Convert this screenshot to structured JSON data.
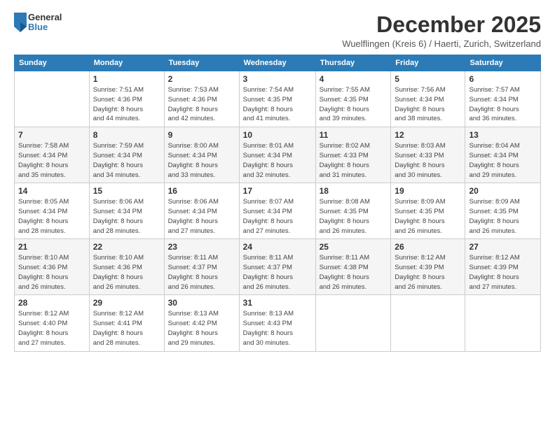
{
  "logo": {
    "general": "General",
    "blue": "Blue"
  },
  "header": {
    "month": "December 2025",
    "location": "Wuelflingen (Kreis 6) / Haerti, Zurich, Switzerland"
  },
  "days_of_week": [
    "Sunday",
    "Monday",
    "Tuesday",
    "Wednesday",
    "Thursday",
    "Friday",
    "Saturday"
  ],
  "weeks": [
    [
      {
        "day": "",
        "info": ""
      },
      {
        "day": "1",
        "info": "Sunrise: 7:51 AM\nSunset: 4:36 PM\nDaylight: 8 hours\nand 44 minutes."
      },
      {
        "day": "2",
        "info": "Sunrise: 7:53 AM\nSunset: 4:36 PM\nDaylight: 8 hours\nand 42 minutes."
      },
      {
        "day": "3",
        "info": "Sunrise: 7:54 AM\nSunset: 4:35 PM\nDaylight: 8 hours\nand 41 minutes."
      },
      {
        "day": "4",
        "info": "Sunrise: 7:55 AM\nSunset: 4:35 PM\nDaylight: 8 hours\nand 39 minutes."
      },
      {
        "day": "5",
        "info": "Sunrise: 7:56 AM\nSunset: 4:34 PM\nDaylight: 8 hours\nand 38 minutes."
      },
      {
        "day": "6",
        "info": "Sunrise: 7:57 AM\nSunset: 4:34 PM\nDaylight: 8 hours\nand 36 minutes."
      }
    ],
    [
      {
        "day": "7",
        "info": "Sunrise: 7:58 AM\nSunset: 4:34 PM\nDaylight: 8 hours\nand 35 minutes."
      },
      {
        "day": "8",
        "info": "Sunrise: 7:59 AM\nSunset: 4:34 PM\nDaylight: 8 hours\nand 34 minutes."
      },
      {
        "day": "9",
        "info": "Sunrise: 8:00 AM\nSunset: 4:34 PM\nDaylight: 8 hours\nand 33 minutes."
      },
      {
        "day": "10",
        "info": "Sunrise: 8:01 AM\nSunset: 4:34 PM\nDaylight: 8 hours\nand 32 minutes."
      },
      {
        "day": "11",
        "info": "Sunrise: 8:02 AM\nSunset: 4:33 PM\nDaylight: 8 hours\nand 31 minutes."
      },
      {
        "day": "12",
        "info": "Sunrise: 8:03 AM\nSunset: 4:33 PM\nDaylight: 8 hours\nand 30 minutes."
      },
      {
        "day": "13",
        "info": "Sunrise: 8:04 AM\nSunset: 4:34 PM\nDaylight: 8 hours\nand 29 minutes."
      }
    ],
    [
      {
        "day": "14",
        "info": "Sunrise: 8:05 AM\nSunset: 4:34 PM\nDaylight: 8 hours\nand 28 minutes."
      },
      {
        "day": "15",
        "info": "Sunrise: 8:06 AM\nSunset: 4:34 PM\nDaylight: 8 hours\nand 28 minutes."
      },
      {
        "day": "16",
        "info": "Sunrise: 8:06 AM\nSunset: 4:34 PM\nDaylight: 8 hours\nand 27 minutes."
      },
      {
        "day": "17",
        "info": "Sunrise: 8:07 AM\nSunset: 4:34 PM\nDaylight: 8 hours\nand 27 minutes."
      },
      {
        "day": "18",
        "info": "Sunrise: 8:08 AM\nSunset: 4:35 PM\nDaylight: 8 hours\nand 26 minutes."
      },
      {
        "day": "19",
        "info": "Sunrise: 8:09 AM\nSunset: 4:35 PM\nDaylight: 8 hours\nand 26 minutes."
      },
      {
        "day": "20",
        "info": "Sunrise: 8:09 AM\nSunset: 4:35 PM\nDaylight: 8 hours\nand 26 minutes."
      }
    ],
    [
      {
        "day": "21",
        "info": "Sunrise: 8:10 AM\nSunset: 4:36 PM\nDaylight: 8 hours\nand 26 minutes."
      },
      {
        "day": "22",
        "info": "Sunrise: 8:10 AM\nSunset: 4:36 PM\nDaylight: 8 hours\nand 26 minutes."
      },
      {
        "day": "23",
        "info": "Sunrise: 8:11 AM\nSunset: 4:37 PM\nDaylight: 8 hours\nand 26 minutes."
      },
      {
        "day": "24",
        "info": "Sunrise: 8:11 AM\nSunset: 4:37 PM\nDaylight: 8 hours\nand 26 minutes."
      },
      {
        "day": "25",
        "info": "Sunrise: 8:11 AM\nSunset: 4:38 PM\nDaylight: 8 hours\nand 26 minutes."
      },
      {
        "day": "26",
        "info": "Sunrise: 8:12 AM\nSunset: 4:39 PM\nDaylight: 8 hours\nand 26 minutes."
      },
      {
        "day": "27",
        "info": "Sunrise: 8:12 AM\nSunset: 4:39 PM\nDaylight: 8 hours\nand 27 minutes."
      }
    ],
    [
      {
        "day": "28",
        "info": "Sunrise: 8:12 AM\nSunset: 4:40 PM\nDaylight: 8 hours\nand 27 minutes."
      },
      {
        "day": "29",
        "info": "Sunrise: 8:12 AM\nSunset: 4:41 PM\nDaylight: 8 hours\nand 28 minutes."
      },
      {
        "day": "30",
        "info": "Sunrise: 8:13 AM\nSunset: 4:42 PM\nDaylight: 8 hours\nand 29 minutes."
      },
      {
        "day": "31",
        "info": "Sunrise: 8:13 AM\nSunset: 4:43 PM\nDaylight: 8 hours\nand 30 minutes."
      },
      {
        "day": "",
        "info": ""
      },
      {
        "day": "",
        "info": ""
      },
      {
        "day": "",
        "info": ""
      }
    ]
  ]
}
